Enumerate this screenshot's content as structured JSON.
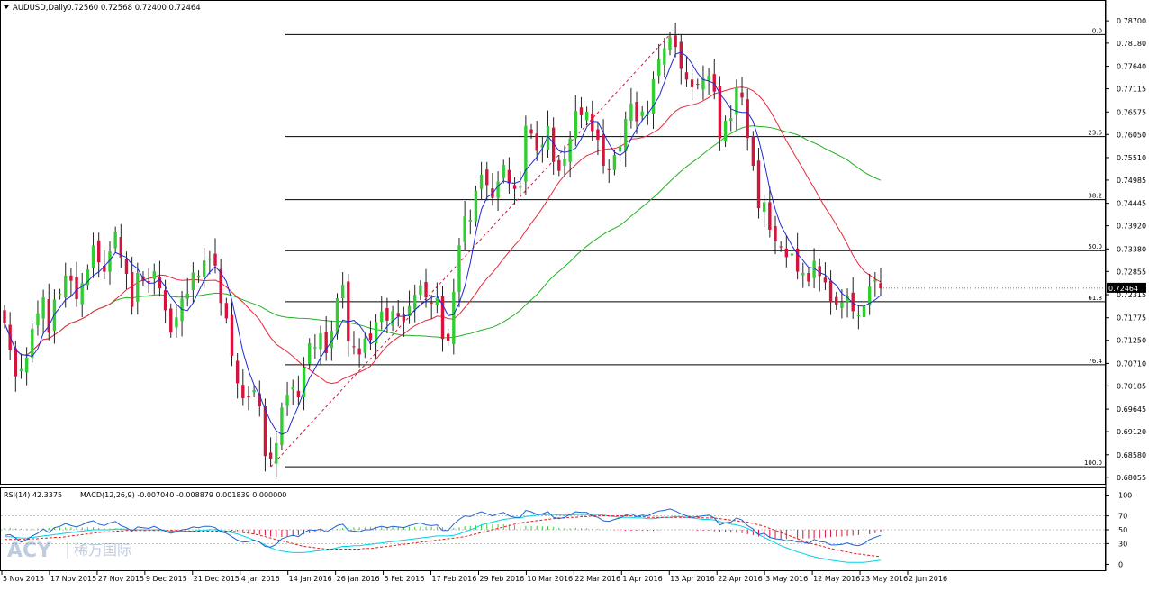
{
  "header": {
    "symbol_label": "AUDUSD,Daily",
    "ohlc_label": "0.72560 0.72568 0.72400 0.72464"
  },
  "indicator_header": {
    "rsi_label": "RSI(14) 42.3375",
    "macd_label": "MACD(12,26,9) -0.007040 -0.008879 0.001839 0.000000"
  },
  "watermark": {
    "text": "ACY",
    "subtext": "稀万国际"
  },
  "colors": {
    "bull": "#32cd32",
    "bear": "#d4143c",
    "ma_fast": "#1e2ad6",
    "ma_mid": "#e8283c",
    "ma_slow": "#22b222",
    "fib": "#000000",
    "rsi": "#1e64d2",
    "macd_main": "#00d2e6",
    "macd_signal": "#e01e1e",
    "grid_text": "#000000",
    "price_tag_bg": "#000000",
    "price_tag_text": "#ffffff"
  },
  "chart_data": [
    {
      "type": "candlestick",
      "title": "AUDUSD,Daily",
      "ylim": [
        0.6805,
        0.7885
      ],
      "current_price": "0.72464",
      "y_ticks": [
        "0.78700",
        "0.78180",
        "0.77640",
        "0.77115",
        "0.76575",
        "0.76050",
        "0.75510",
        "0.74985",
        "0.74445",
        "0.73920",
        "0.73380",
        "0.72855",
        "0.72315",
        "0.71775",
        "0.71250",
        "0.70710",
        "0.70185",
        "0.69645",
        "0.69120",
        "0.68580",
        "0.68055"
      ],
      "x_ticks": [
        "5 Nov 2015",
        "17 Nov 2015",
        "27 Nov 2015",
        "9 Dec 2015",
        "21 Dec 2015",
        "4 Jan 2016",
        "14 Jan 2016",
        "26 Jan 2016",
        "5 Feb 2016",
        "17 Feb 2016",
        "29 Feb 2016",
        "10 Mar 2016",
        "22 Mar 2016",
        "1 Apr 2016",
        "13 Apr 2016",
        "22 Apr 2016",
        "3 May 2016",
        "12 May 2016",
        "23 May 2016",
        "2 Jun 2016"
      ],
      "fibonacci": {
        "start_price": 0.683,
        "end_price": 0.7838,
        "levels": [
          {
            "label": "0.0",
            "ratio": 0.0
          },
          {
            "label": "23.6",
            "ratio": 0.236
          },
          {
            "label": "38.2",
            "ratio": 0.382
          },
          {
            "label": "50.0",
            "ratio": 0.5
          },
          {
            "label": "61.8",
            "ratio": 0.618
          },
          {
            "label": "76.4",
            "ratio": 0.764
          },
          {
            "label": "100.0",
            "ratio": 1.0
          }
        ]
      },
      "series": [
        {
          "name": "",
          "type": "candles",
          "close": [
            0.7165,
            0.7102,
            0.7041,
            0.7058,
            0.7085,
            0.7152,
            0.7188,
            0.7225,
            0.7143,
            0.722,
            0.7233,
            0.7276,
            0.7264,
            0.7221,
            0.7258,
            0.729,
            0.7346,
            0.7307,
            0.7285,
            0.7332,
            0.7378,
            0.7318,
            0.728,
            0.7203,
            0.7282,
            0.7263,
            0.726,
            0.7286,
            0.7246,
            0.7195,
            0.7143,
            0.7178,
            0.7222,
            0.7234,
            0.7283,
            0.7276,
            0.7311,
            0.7315,
            0.7299,
            0.7212,
            0.7176,
            0.7089,
            0.7025,
            0.699,
            0.6992,
            0.7009,
            0.6971,
            0.6855,
            0.6849,
            0.6885,
            0.6968,
            0.6998,
            0.7015,
            0.6992,
            0.7062,
            0.7118,
            0.7109,
            0.7141,
            0.7095,
            0.7147,
            0.7223,
            0.7254,
            0.7123,
            0.711,
            0.7092,
            0.7129,
            0.7126,
            0.7168,
            0.7192,
            0.7171,
            0.7193,
            0.7181,
            0.7169,
            0.7205,
            0.7231,
            0.7253,
            0.7225,
            0.7211,
            0.7224,
            0.7128,
            0.7124,
            0.7238,
            0.7346,
            0.7414,
            0.7406,
            0.7474,
            0.7511,
            0.7487,
            0.7457,
            0.7495,
            0.7534,
            0.7491,
            0.7478,
            0.7483,
            0.7625,
            0.7607,
            0.7567,
            0.7581,
            0.7625,
            0.7541,
            0.752,
            0.7549,
            0.7596,
            0.766,
            0.765,
            0.7658,
            0.7613,
            0.7593,
            0.7532,
            0.7522,
            0.7557,
            0.7578,
            0.7641,
            0.7677,
            0.7636,
            0.7659,
            0.7654,
            0.7734,
            0.778,
            0.7806,
            0.7832,
            0.7809,
            0.7758,
            0.7733,
            0.7715,
            0.7722,
            0.7736,
            0.7742,
            0.7705,
            0.7596,
            0.7637,
            0.7643,
            0.7715,
            0.7691,
            0.7597,
            0.7532,
            0.7433,
            0.7447,
            0.7383,
            0.7356,
            0.7343,
            0.7319,
            0.7327,
            0.7285,
            0.7282,
            0.7262,
            0.731,
            0.7275,
            0.726,
            0.7214,
            0.7208,
            0.7214,
            0.7228,
            0.7193,
            0.7183,
            0.7204,
            0.725,
            0.7266,
            0.7246
          ]
        },
        {
          "name": "",
          "type": "line",
          "ma_period": 5
        },
        {
          "name": "",
          "type": "line",
          "ma_period": 20
        },
        {
          "name": "",
          "type": "line",
          "ma_period": 50
        }
      ]
    },
    {
      "type": "line",
      "title": "RSI(14) 42.3375 MACD(12,26,9) -0.007040 -0.008879 0.001839 0.000000",
      "ylim": [
        -2,
        102
      ],
      "y_ticks": [
        "100",
        "70",
        "50",
        "30",
        "0"
      ],
      "levels": [
        70,
        50,
        30
      ],
      "series": [
        {
          "name": "RSI(14)",
          "values": [
            42,
            43,
            38,
            32,
            36,
            41,
            45,
            51,
            46,
            53,
            55,
            59,
            56,
            54,
            57,
            61,
            63,
            58,
            56,
            60,
            62,
            56,
            53,
            48,
            54,
            53,
            52,
            55,
            51,
            48,
            45,
            47,
            50,
            51,
            54,
            53,
            55,
            55,
            53,
            47,
            45,
            40,
            35,
            32,
            33,
            35,
            32,
            26,
            25,
            29,
            37,
            40,
            42,
            40,
            46,
            50,
            49,
            51,
            47,
            51,
            56,
            58,
            49,
            48,
            47,
            50,
            50,
            53,
            55,
            53,
            55,
            54,
            53,
            56,
            58,
            60,
            57,
            56,
            57,
            49,
            49,
            58,
            65,
            70,
            69,
            73,
            76,
            73,
            70,
            73,
            75,
            70,
            68,
            68,
            78,
            76,
            72,
            73,
            76,
            68,
            66,
            68,
            72,
            76,
            75,
            75,
            70,
            68,
            63,
            62,
            65,
            67,
            71,
            73,
            69,
            71,
            70,
            74,
            77,
            78,
            80,
            77,
            73,
            70,
            68,
            69,
            70,
            71,
            67,
            57,
            60,
            61,
            67,
            64,
            56,
            51,
            43,
            45,
            39,
            37,
            36,
            34,
            35,
            32,
            32,
            30,
            36,
            33,
            32,
            28,
            28,
            29,
            31,
            28,
            27,
            30,
            36,
            39,
            42
          ]
        },
        {
          "name": "MACD(12,26,9)",
          "values": [
            40,
            40,
            39,
            38,
            38,
            39,
            40,
            41,
            42,
            43,
            44,
            45,
            46,
            47,
            48,
            49,
            50,
            50,
            50,
            50,
            51,
            51,
            51,
            50,
            50,
            50,
            50,
            50,
            50,
            49,
            48,
            48,
            48,
            48,
            48,
            49,
            49,
            50,
            50,
            49,
            48,
            46,
            44,
            41,
            38,
            35,
            32,
            28,
            24,
            21,
            19,
            18,
            17,
            17,
            17,
            18,
            19,
            20,
            21,
            22,
            24,
            26,
            26,
            27,
            27,
            28,
            29,
            30,
            31,
            32,
            33,
            34,
            35,
            36,
            37,
            38,
            39,
            40,
            41,
            41,
            41,
            42,
            44,
            47,
            50,
            53,
            57,
            59,
            61,
            63,
            65,
            66,
            67,
            67,
            69,
            70,
            71,
            71,
            72,
            72,
            71,
            71,
            71,
            72,
            72,
            72,
            72,
            72,
            71,
            70,
            69,
            68,
            68,
            68,
            67,
            67,
            66,
            66,
            67,
            68,
            68,
            69,
            69,
            68,
            67,
            66,
            65,
            65,
            64,
            62,
            60,
            58,
            57,
            55,
            52,
            48,
            43,
            39,
            35,
            31,
            27,
            24,
            21,
            18,
            16,
            13,
            11,
            9,
            8,
            6,
            5,
            4,
            3,
            3,
            3,
            3,
            4,
            5,
            6
          ]
        },
        {
          "name": "",
          "values": [
            36,
            36,
            36,
            36,
            36,
            37,
            37,
            38,
            38,
            39,
            39,
            40,
            41,
            42,
            43,
            44,
            45,
            46,
            47,
            47,
            48,
            48,
            49,
            49,
            49,
            49,
            49,
            49,
            49,
            49,
            49,
            49,
            49,
            48,
            48,
            48,
            48,
            48,
            48,
            48,
            48,
            48,
            47,
            46,
            45,
            44,
            42,
            40,
            38,
            36,
            34,
            32,
            30,
            28,
            26,
            25,
            24,
            23,
            22,
            22,
            22,
            22,
            22,
            22,
            22,
            23,
            23,
            24,
            25,
            26,
            27,
            28,
            29,
            30,
            31,
            32,
            33,
            34,
            35,
            36,
            37,
            38,
            39,
            40,
            42,
            44,
            46,
            48,
            50,
            52,
            54,
            56,
            58,
            60,
            61,
            62,
            63,
            64,
            65,
            66,
            67,
            67,
            68,
            68,
            69,
            69,
            70,
            70,
            70,
            70,
            70,
            70,
            70,
            70,
            69,
            69,
            68,
            68,
            68,
            68,
            68,
            68,
            68,
            68,
            68,
            68,
            67,
            67,
            67,
            66,
            65,
            64,
            63,
            62,
            61,
            59,
            57,
            55,
            52,
            49,
            46,
            43,
            40,
            37,
            34,
            31,
            29,
            27,
            25,
            23,
            21,
            19,
            18,
            16,
            15,
            14,
            13,
            12,
            11
          ]
        }
      ],
      "histogram": [
        4,
        4,
        3,
        2,
        2,
        2,
        3,
        3,
        4,
        4,
        5,
        5,
        5,
        5,
        5,
        5,
        5,
        4,
        3,
        3,
        3,
        3,
        2,
        1,
        1,
        1,
        1,
        1,
        1,
        0,
        -1,
        -1,
        -1,
        0,
        0,
        1,
        1,
        2,
        2,
        1,
        0,
        -2,
        -3,
        -5,
        -7,
        -9,
        -10,
        -12,
        -14,
        -15,
        -15,
        -14,
        -13,
        -11,
        -9,
        -7,
        -5,
        -3,
        -1,
        0,
        2,
        4,
        4,
        5,
        5,
        5,
        6,
        6,
        6,
        6,
        6,
        6,
        6,
        6,
        6,
        6,
        6,
        6,
        6,
        5,
        4,
        4,
        5,
        7,
        8,
        9,
        11,
        11,
        11,
        11,
        11,
        10,
        9,
        7,
        8,
        8,
        8,
        7,
        7,
        6,
        4,
        4,
        3,
        4,
        3,
        3,
        2,
        2,
        1,
        0,
        -1,
        -2,
        -2,
        -2,
        -2,
        -2,
        -2,
        -2,
        -1,
        0,
        0,
        1,
        1,
        0,
        -1,
        -2,
        -2,
        -2,
        -3,
        -4,
        -5,
        -6,
        -6,
        -7,
        -9,
        -11,
        -14,
        -16,
        -17,
        -18,
        -19,
        -19,
        -19,
        -19,
        -18,
        -18,
        -18,
        -17,
        -16,
        -15,
        -14,
        -14,
        -13,
        -12,
        -11,
        -10,
        -9,
        -7,
        -4
      ]
    }
  ]
}
